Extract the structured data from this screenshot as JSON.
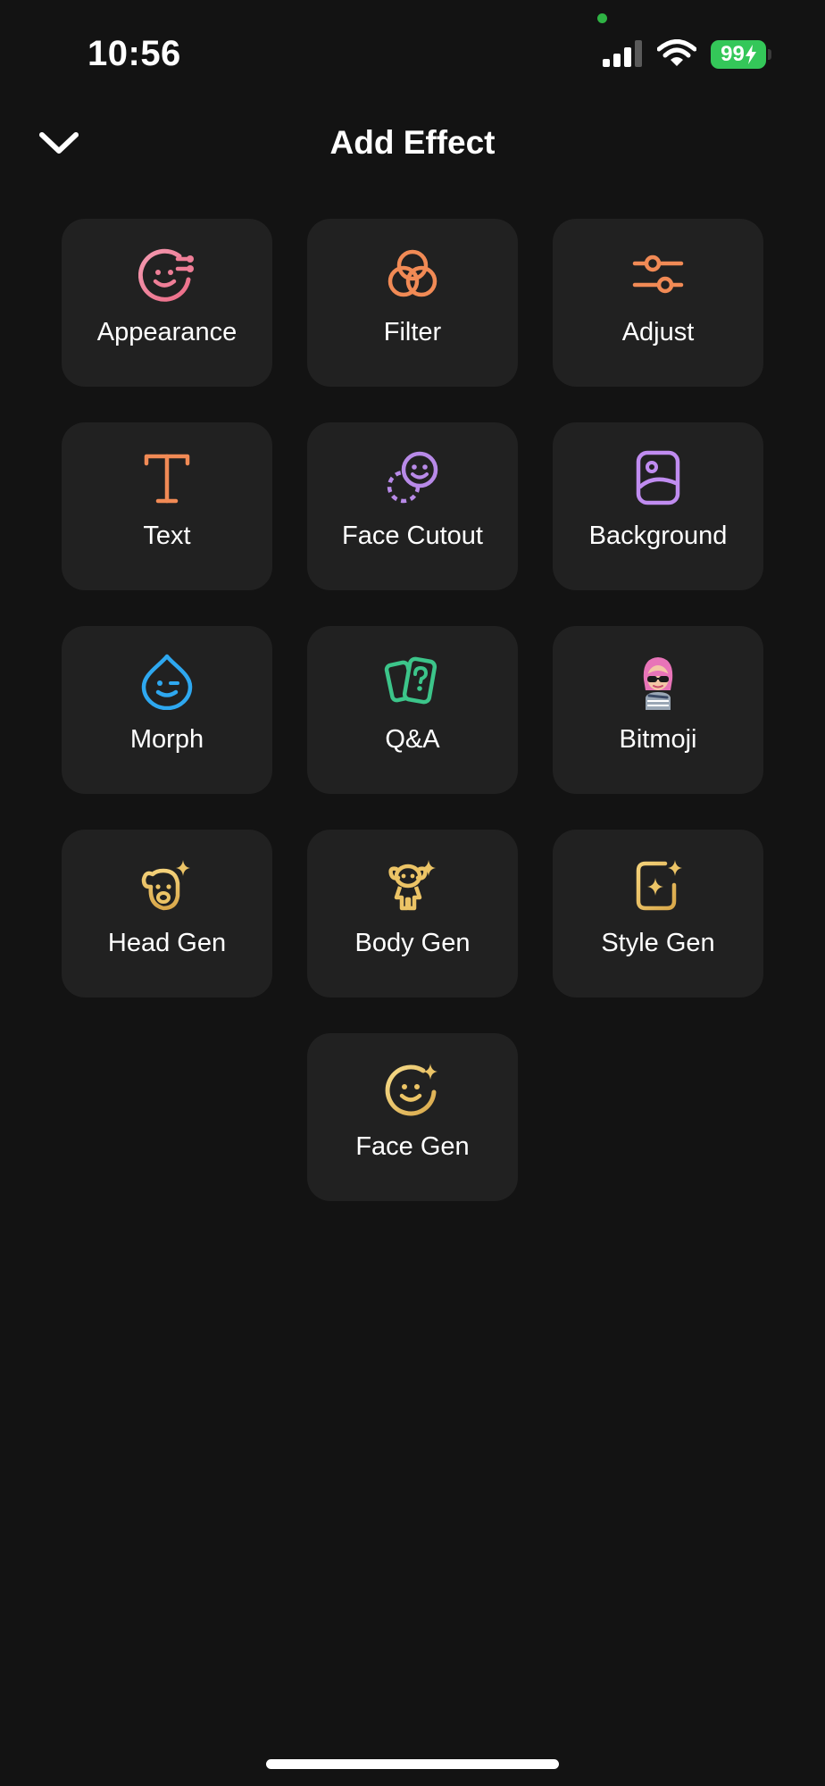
{
  "status_bar": {
    "time": "10:56",
    "battery_level": "99",
    "camera_indicator_color": "#2fb344",
    "battery_color": "#34c759"
  },
  "header": {
    "title": "Add Effect",
    "back_icon": "chevron-down-icon"
  },
  "effects": [
    {
      "label": "Appearance",
      "icon": "face-appearance-icon",
      "color": "#f07e96"
    },
    {
      "label": "Filter",
      "icon": "filter-circles-icon",
      "color": "#f18a55"
    },
    {
      "label": "Adjust",
      "icon": "sliders-icon",
      "color": "#f18a55"
    },
    {
      "label": "Text",
      "icon": "text-t-icon",
      "color": "#f18a55"
    },
    {
      "label": "Face Cutout",
      "icon": "face-cutout-icon",
      "color": "#b88ae8"
    },
    {
      "label": "Background",
      "icon": "background-image-icon",
      "color": "#c08cf0"
    },
    {
      "label": "Morph",
      "icon": "morph-drop-face-icon",
      "color": "#2ea8f0"
    },
    {
      "label": "Q&A",
      "icon": "qa-cards-icon",
      "color": "#3cc58a"
    },
    {
      "label": "Bitmoji",
      "icon": "bitmoji-avatar-icon",
      "color": "#e874b8"
    },
    {
      "label": "Head Gen",
      "icon": "head-gen-sparkle-icon",
      "color": "#ecc466"
    },
    {
      "label": "Body Gen",
      "icon": "body-gen-sparkle-icon",
      "color": "#ecc466"
    },
    {
      "label": "Style Gen",
      "icon": "style-gen-sparkle-icon",
      "color": "#ecc466"
    },
    {
      "label": "Face Gen",
      "icon": "face-gen-sparkle-icon",
      "color": "#ecc466"
    }
  ]
}
